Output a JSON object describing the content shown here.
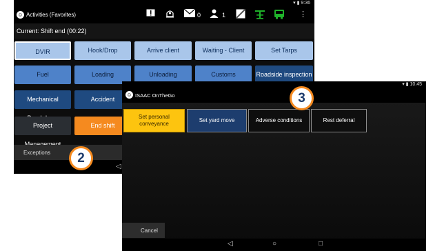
{
  "back_screen": {
    "status_time": "9:36",
    "app_title": "Activities (Favorites)",
    "badge_messages": "0",
    "badge_users": "1",
    "subtitle": "Current: Shift end (00:22)",
    "tiles": [
      "DVIR",
      "Hook/Drop",
      "Arrive client",
      "Waiting - Client",
      "Set Tarps",
      "Fuel",
      "Loading",
      "Unloading",
      "Customs",
      "Roadside inspection",
      "Mechanical Breakdown",
      "Accident",
      "Project Management",
      "End shift"
    ],
    "exceptions_label": "Exceptions",
    "nav_back": "◁"
  },
  "front_screen": {
    "status_time": "10:45",
    "app_title": "ISAAC OnTheGo",
    "tiles": [
      "Set personal conveyance",
      "Set yard move",
      "Adverse conditions",
      "Rest deferral"
    ],
    "cancel_label": "Cancel",
    "nav_back": "◁",
    "nav_home": "○",
    "nav_recent": "□"
  },
  "callouts": [
    "2",
    "3"
  ],
  "icons": [
    "app-logo-icon",
    "alert-icon",
    "person-bell-icon",
    "mail-icon",
    "user-icon",
    "no-signal-icon",
    "tower-icon",
    "bus-icon",
    "menu-dots-icon",
    "wifi-icon",
    "battery-icon"
  ],
  "colors": {
    "accent_orange": "#f58a1f",
    "tile_light_blue": "#a9c6ea",
    "tile_blue": "#4e82c9",
    "tile_navy": "#1f4a80",
    "tile_yellow": "#fdc40f"
  }
}
